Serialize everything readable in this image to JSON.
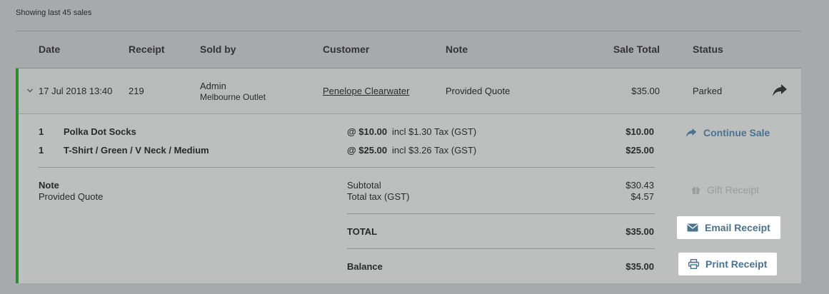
{
  "summary": {
    "count_text": "Showing last 45 sales"
  },
  "table": {
    "headers": {
      "date": "Date",
      "receipt": "Receipt",
      "sold_by": "Sold by",
      "customer": "Customer",
      "note": "Note",
      "sale_total": "Sale Total",
      "status": "Status"
    },
    "sale": {
      "date": "17 Jul 2018 13:40",
      "receipt": "219",
      "sold_by": "Admin",
      "outlet": "Melbourne Outlet",
      "customer": "Penelope Clearwater",
      "note": "Provided Quote",
      "total": "$35.00",
      "status": "Parked"
    }
  },
  "details": {
    "line_items": [
      {
        "qty": "1",
        "name": "Polka Dot Socks",
        "unit_price": "@ $10.00",
        "tax": "incl $1.30 Tax (GST)",
        "total": "$10.00"
      },
      {
        "qty": "1",
        "name": "T-Shirt / Green / V Neck / Medium",
        "unit_price": "@ $25.00",
        "tax": "incl $3.26 Tax (GST)",
        "total": "$25.00"
      }
    ],
    "note_label": "Note",
    "note_value": "Provided Quote",
    "subtotal_label": "Subtotal",
    "subtotal_value": "$30.43",
    "tax_label": "Total tax (GST)",
    "tax_value": "$4.57",
    "total_label": "TOTAL",
    "total_value": "$35.00",
    "balance_label": "Balance",
    "balance_value": "$35.00"
  },
  "actions": {
    "continue_sale": "Continue Sale",
    "gift_receipt": "Gift Receipt",
    "email_receipt": "Email Receipt",
    "print_receipt": "Print Receipt"
  },
  "icons": {
    "expand": "chevron-down-icon",
    "share": "share-arrow-icon",
    "continue": "share-arrow-icon",
    "gift": "gift-icon",
    "email": "envelope-icon",
    "print": "printer-icon"
  },
  "colors": {
    "background": "#a7aaaa",
    "accent_bar": "#2e8a37",
    "action_link": "#4a7390"
  }
}
